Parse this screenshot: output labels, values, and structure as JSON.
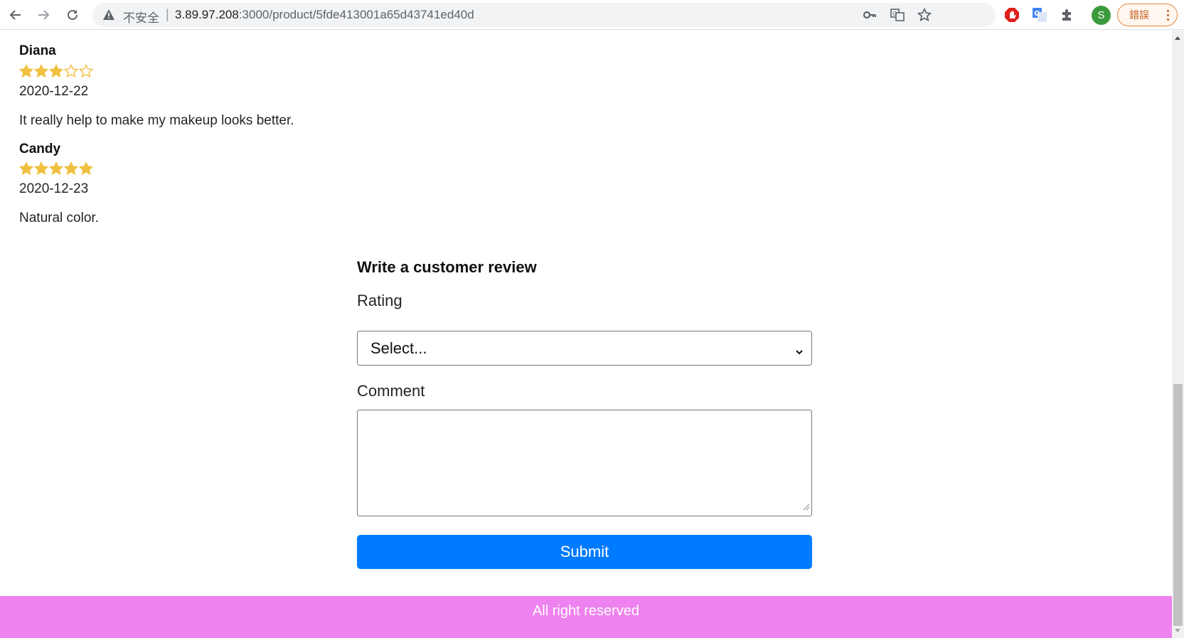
{
  "browser": {
    "security_label": "不安全",
    "url_host": "3.89.97.208",
    "url_rest": ":3000/product/5fde413001a65d43741ed40d",
    "profile_initial": "S",
    "error_label": "錯誤"
  },
  "reviews": [
    {
      "name": "Diana",
      "rating": 3,
      "max_rating": 5,
      "date": "2020-12-22",
      "comment": "It really help to make my makeup looks better."
    },
    {
      "name": "Candy",
      "rating": 5,
      "max_rating": 5,
      "date": "2020-12-23",
      "comment": "Natural color."
    }
  ],
  "review_form": {
    "title": "Write a customer review",
    "rating_label": "Rating",
    "rating_selected": "Select...",
    "comment_label": "Comment",
    "comment_value": "",
    "submit_label": "Submit"
  },
  "footer": {
    "text": "All right reserved"
  },
  "colors": {
    "star": "#f0c040",
    "submit": "#007bff",
    "footer_bg": "#ee82ee",
    "avatar": "#3c9a3c",
    "error_pill": "#e8873a"
  },
  "scroll": {
    "position_fraction": 1.0
  }
}
